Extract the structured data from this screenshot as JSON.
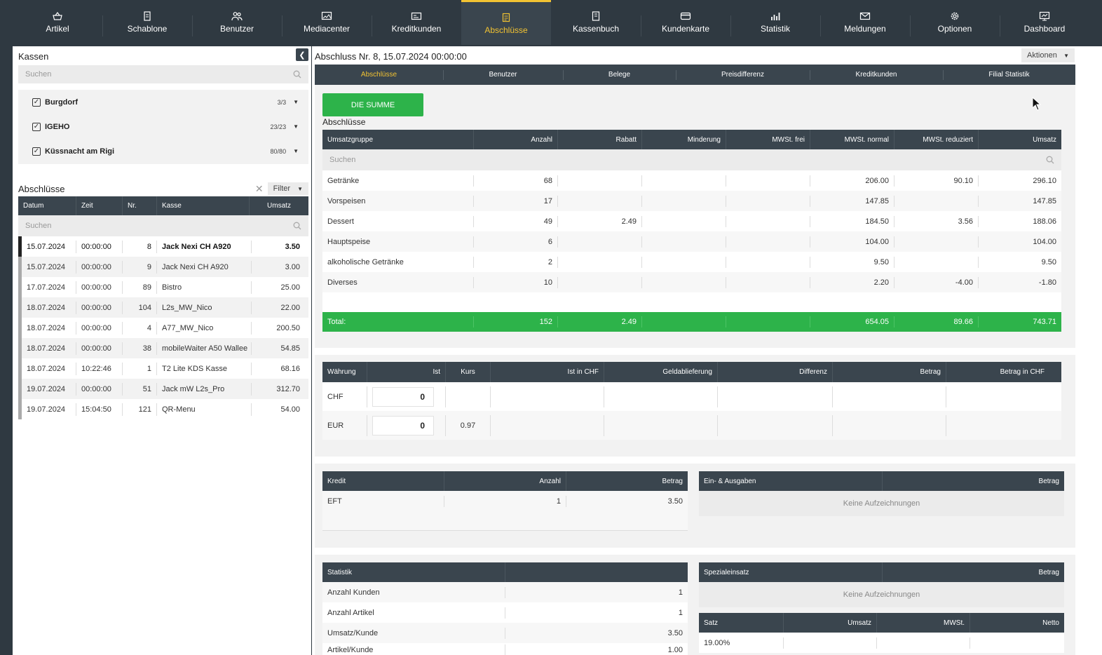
{
  "nav": [
    {
      "label": "Artikel",
      "icon": "basket-icon"
    },
    {
      "label": "Schablone",
      "icon": "template-icon"
    },
    {
      "label": "Benutzer",
      "icon": "users-icon"
    },
    {
      "label": "Mediacenter",
      "icon": "media-icon"
    },
    {
      "label": "Kreditkunden",
      "icon": "id-card-icon"
    },
    {
      "label": "Abschlüsse",
      "icon": "closing-icon",
      "active": true
    },
    {
      "label": "Kassenbuch",
      "icon": "book-icon"
    },
    {
      "label": "Kundenkarte",
      "icon": "card-icon"
    },
    {
      "label": "Statistik",
      "icon": "chart-icon"
    },
    {
      "label": "Meldungen",
      "icon": "mail-icon"
    },
    {
      "label": "Optionen",
      "icon": "gear-icon"
    },
    {
      "label": "Dashboard",
      "icon": "dashboard-icon"
    }
  ],
  "left": {
    "kassen_title": "Kassen",
    "search_placeholder": "Suchen",
    "kassen": [
      {
        "name": "Burgdorf",
        "count": "3/3"
      },
      {
        "name": "IGEHO",
        "count": "23/23"
      },
      {
        "name": "Küssnacht am Rigi",
        "count": "80/80"
      }
    ],
    "abschluesse_title": "Abschlüsse",
    "filter_label": "Filter",
    "columns": [
      "Datum",
      "Zeit",
      "Nr.",
      "Kasse",
      "Umsatz"
    ],
    "rows": [
      {
        "datum": "15.07.2024",
        "zeit": "00:00:00",
        "nr": "8",
        "kasse": "Jack Nexi CH A920",
        "umsatz": "3.50",
        "selected": true
      },
      {
        "datum": "15.07.2024",
        "zeit": "00:00:00",
        "nr": "9",
        "kasse": "Jack Nexi CH A920",
        "umsatz": "3.00"
      },
      {
        "datum": "17.07.2024",
        "zeit": "00:00:00",
        "nr": "89",
        "kasse": "Bistro",
        "umsatz": "25.00"
      },
      {
        "datum": "18.07.2024",
        "zeit": "00:00:00",
        "nr": "104",
        "kasse": "L2s_MW_Nico",
        "umsatz": "22.00"
      },
      {
        "datum": "18.07.2024",
        "zeit": "00:00:00",
        "nr": "4",
        "kasse": "A77_MW_Nico",
        "umsatz": "200.50"
      },
      {
        "datum": "18.07.2024",
        "zeit": "00:00:00",
        "nr": "38",
        "kasse": "mobileWaiter A50 Wallee",
        "umsatz": "54.85"
      },
      {
        "datum": "18.07.2024",
        "zeit": "10:22:46",
        "nr": "1",
        "kasse": "T2 Lite KDS Kasse",
        "umsatz": "68.16"
      },
      {
        "datum": "19.07.2024",
        "zeit": "00:00:00",
        "nr": "51",
        "kasse": "Jack mW L2s_Pro",
        "umsatz": "312.70"
      },
      {
        "datum": "19.07.2024",
        "zeit": "15:04:50",
        "nr": "121",
        "kasse": "QR-Menu",
        "umsatz": "54.00"
      }
    ]
  },
  "right": {
    "title": "Abschluss Nr. 8, 15.07.2024 00:00:00",
    "aktionen_label": "Aktionen",
    "tabs": [
      "Abschlüsse",
      "Benutzer",
      "Belege",
      "Preisdifferenz",
      "Kreditkunden",
      "Filial Statistik"
    ],
    "summe_button": "DIE SUMME",
    "section_title": "Abschlüsse",
    "group_columns": [
      "Umsatzgruppe",
      "Anzahl",
      "Rabatt",
      "Minderung",
      "MWSt. frei",
      "MWSt. normal",
      "MWSt. reduziert",
      "Umsatz"
    ],
    "search_placeholder": "Suchen",
    "group_rows": [
      [
        "Getränke",
        "68",
        "",
        "",
        "",
        "206.00",
        "90.10",
        "296.10"
      ],
      [
        "Vorspeisen",
        "17",
        "",
        "",
        "",
        "147.85",
        "",
        "147.85"
      ],
      [
        "Dessert",
        "49",
        "2.49",
        "",
        "",
        "184.50",
        "3.56",
        "188.06"
      ],
      [
        "Hauptspeise",
        "6",
        "",
        "",
        "",
        "104.00",
        "",
        "104.00"
      ],
      [
        "alkoholische Getränke",
        "2",
        "",
        "",
        "",
        "9.50",
        "",
        "9.50"
      ],
      [
        "Diverses",
        "10",
        "",
        "",
        "",
        "2.20",
        "-4.00",
        "-1.80"
      ]
    ],
    "total": [
      "Total:",
      "152",
      "2.49",
      "",
      "",
      "654.05",
      "89.66",
      "743.71"
    ],
    "currency_columns": [
      "Währung",
      "Ist",
      "Kurs",
      "Ist in CHF",
      "Geldablieferung",
      "Differenz",
      "Betrag",
      "Betrag in CHF"
    ],
    "currency_rows": [
      {
        "waehrung": "CHF",
        "ist": "0",
        "kurs": ""
      },
      {
        "waehrung": "EUR",
        "ist": "0",
        "kurs": "0.97"
      }
    ],
    "kredit": {
      "columns": [
        "Kredit",
        "Anzahl",
        "Betrag"
      ],
      "rows": [
        [
          "EFT",
          "1",
          "3.50"
        ]
      ]
    },
    "einausgaben": {
      "columns": [
        "Ein- & Ausgaben",
        "Betrag"
      ],
      "empty": "Keine Aufzeichnungen"
    },
    "statistik": {
      "columns": [
        "Statistik",
        ""
      ],
      "rows": [
        [
          "Anzahl Kunden",
          "1"
        ],
        [
          "Anzahl Artikel",
          "1"
        ],
        [
          "Umsatz/Kunde",
          "3.50"
        ],
        [
          "Artikel/Kunde",
          "1.00"
        ]
      ]
    },
    "spezialeinsatz": {
      "columns": [
        "Spezialeinsatz",
        "Betrag"
      ],
      "empty": "Keine Aufzeichnungen"
    },
    "satz": {
      "columns": [
        "Satz",
        "Umsatz",
        "MWSt.",
        "Netto"
      ],
      "rows": [
        [
          "19.00%",
          "",
          "",
          ""
        ]
      ]
    }
  },
  "colors": {
    "accent": "#f1c232",
    "green": "#2db34a",
    "dark": "#2f3941"
  }
}
